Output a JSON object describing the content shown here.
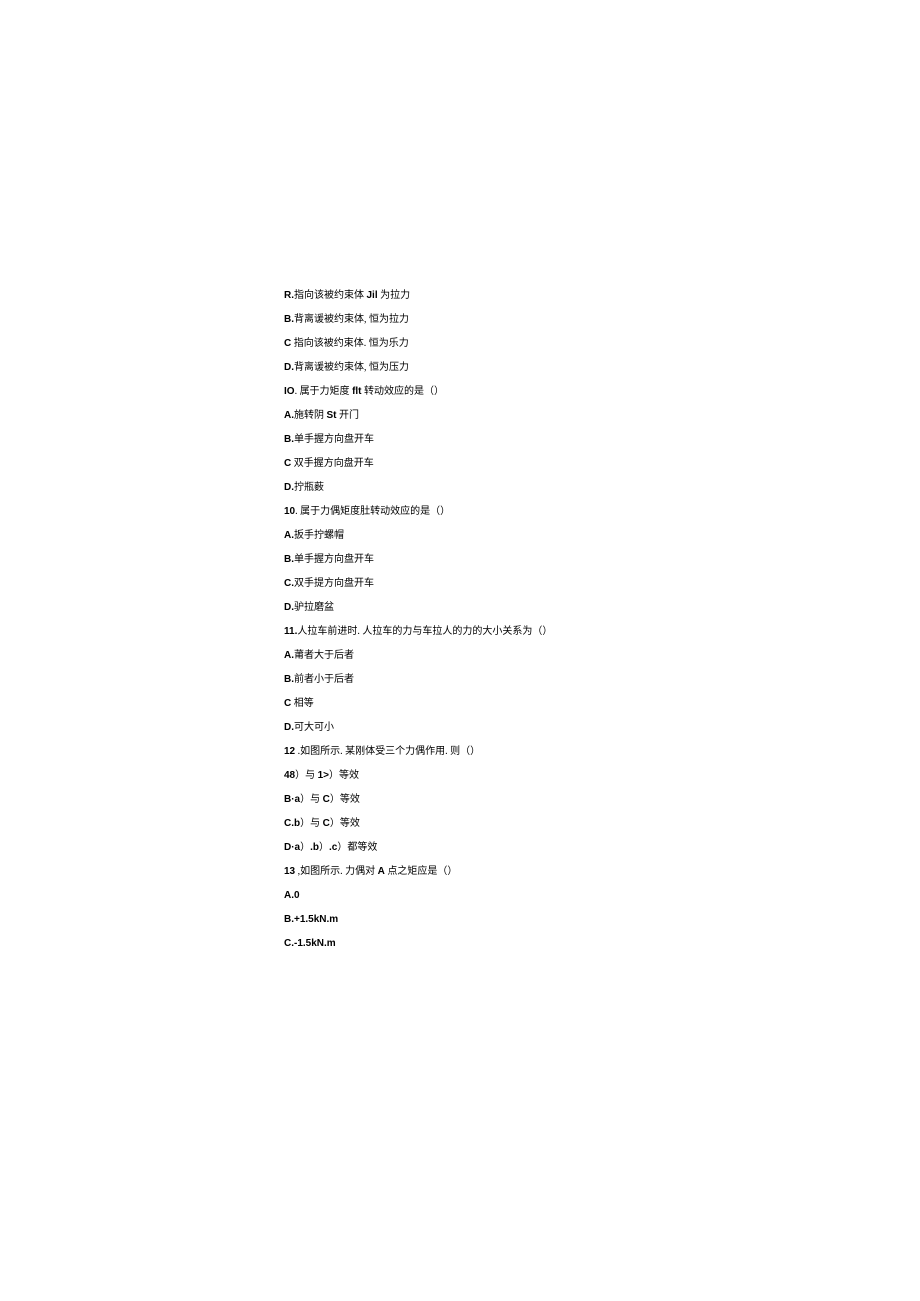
{
  "lines": [
    {
      "parts": [
        {
          "t": "R.",
          "b": true
        },
        {
          "t": "指向该被约束体 ",
          "b": false
        },
        {
          "t": "Jil",
          "b": true
        },
        {
          "t": " 为拉力",
          "b": false
        }
      ]
    },
    {
      "parts": [
        {
          "t": "B.",
          "b": true
        },
        {
          "t": "背离谖被约束体, 恒为拉力",
          "b": false
        }
      ]
    },
    {
      "parts": [
        {
          "t": "C",
          "b": true
        },
        {
          "t": " 指向该被约束体. 恒为乐力",
          "b": false
        }
      ]
    },
    {
      "parts": [
        {
          "t": "D.",
          "b": true
        },
        {
          "t": "背离谖被约束体, 恒为压力",
          "b": false
        }
      ]
    },
    {
      "parts": [
        {
          "t": "IO",
          "b": true
        },
        {
          "t": ". 属于力矩度 ",
          "b": false
        },
        {
          "t": "flt",
          "b": true
        },
        {
          "t": " 转动效应的是（）",
          "b": false
        }
      ]
    },
    {
      "parts": [
        {
          "t": "A.",
          "b": true
        },
        {
          "t": "施转阴 ",
          "b": false
        },
        {
          "t": "St",
          "b": true
        },
        {
          "t": " 开门",
          "b": false
        }
      ]
    },
    {
      "parts": [
        {
          "t": "B.",
          "b": true
        },
        {
          "t": "单手握方向盘开车",
          "b": false
        }
      ]
    },
    {
      "parts": [
        {
          "t": "C",
          "b": true
        },
        {
          "t": " 双手握方向盘开车",
          "b": false
        }
      ]
    },
    {
      "parts": [
        {
          "t": "D.",
          "b": true
        },
        {
          "t": "拧瓶薮",
          "b": false
        }
      ]
    },
    {
      "parts": [
        {
          "t": "10",
          "b": true
        },
        {
          "t": ". 属于力偶矩度肚转动效应的是（）",
          "b": false
        }
      ]
    },
    {
      "parts": [
        {
          "t": "A.",
          "b": true
        },
        {
          "t": "扳手拧螺帽",
          "b": false
        }
      ]
    },
    {
      "parts": [
        {
          "t": "B.",
          "b": true
        },
        {
          "t": "单手握方向盘开车",
          "b": false
        }
      ]
    },
    {
      "parts": [
        {
          "t": "C.",
          "b": true
        },
        {
          "t": "双手提方向盘开车",
          "b": false
        }
      ]
    },
    {
      "parts": [
        {
          "t": "D.",
          "b": true
        },
        {
          "t": "驴拉磨盆",
          "b": false
        }
      ]
    },
    {
      "parts": [
        {
          "t": "11.",
          "b": true
        },
        {
          "t": "人拉车前进时. 人拉车的力与车拉人的力的大小关系为（）",
          "b": false
        }
      ]
    },
    {
      "parts": [
        {
          "t": "A.",
          "b": true
        },
        {
          "t": "莆者大于后者",
          "b": false
        }
      ]
    },
    {
      "parts": [
        {
          "t": "B.",
          "b": true
        },
        {
          "t": "前者小于后者",
          "b": false
        }
      ]
    },
    {
      "parts": [
        {
          "t": "C",
          "b": true
        },
        {
          "t": " 相等",
          "b": false
        }
      ]
    },
    {
      "parts": [
        {
          "t": "D.",
          "b": true
        },
        {
          "t": "可大可小",
          "b": false
        }
      ]
    },
    {
      "parts": [
        {
          "t": "12",
          "b": true
        },
        {
          "t": "     .如图所示. 某刚体受三个力偶作用. 则（）",
          "b": false
        }
      ]
    },
    {
      "parts": [
        {
          "t": "48",
          "b": true
        },
        {
          "t": "）与 ",
          "b": false
        },
        {
          "t": "1>",
          "b": true
        },
        {
          "t": "）等效",
          "b": false
        }
      ]
    },
    {
      "parts": [
        {
          "t": "B·a",
          "b": true
        },
        {
          "t": "）与 ",
          "b": false
        },
        {
          "t": "C",
          "b": true
        },
        {
          "t": "）等效",
          "b": false
        }
      ]
    },
    {
      "parts": [
        {
          "t": "C.b",
          "b": true
        },
        {
          "t": "）与 ",
          "b": false
        },
        {
          "t": "C",
          "b": true
        },
        {
          "t": "）等效",
          "b": false
        }
      ]
    },
    {
      "parts": [
        {
          "t": "D·a",
          "b": true
        },
        {
          "t": "）",
          "b": false
        },
        {
          "t": ".b",
          "b": true
        },
        {
          "t": "）",
          "b": false
        },
        {
          "t": ".c",
          "b": true
        },
        {
          "t": "）都等效",
          "b": false
        }
      ]
    },
    {
      "parts": [
        {
          "t": "13",
          "b": true
        },
        {
          "t": "     ,如图所示. 力偶对 ",
          "b": false
        },
        {
          "t": "A",
          "b": true
        },
        {
          "t": " 点之矩应是（）",
          "b": false
        }
      ]
    },
    {
      "parts": [
        {
          "t": "A.0",
          "b": true
        }
      ]
    },
    {
      "parts": [
        {
          "t": "B.+1.5kN.m",
          "b": true
        }
      ]
    },
    {
      "parts": [
        {
          "t": "C.-1.5kN.m",
          "b": true
        }
      ]
    }
  ]
}
